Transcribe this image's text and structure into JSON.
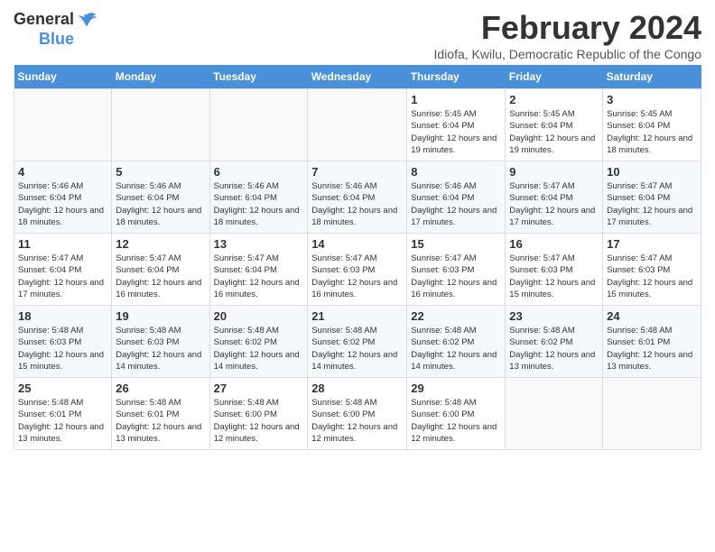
{
  "logo": {
    "text_general": "General",
    "text_blue": "Blue"
  },
  "header": {
    "title": "February 2024",
    "subtitle": "Idiofa, Kwilu, Democratic Republic of the Congo"
  },
  "weekdays": [
    "Sunday",
    "Monday",
    "Tuesday",
    "Wednesday",
    "Thursday",
    "Friday",
    "Saturday"
  ],
  "weeks": [
    [
      {
        "day": "",
        "empty": true
      },
      {
        "day": "",
        "empty": true
      },
      {
        "day": "",
        "empty": true
      },
      {
        "day": "",
        "empty": true
      },
      {
        "day": "1",
        "sunrise": "5:45 AM",
        "sunset": "6:04 PM",
        "daylight": "12 hours and 19 minutes."
      },
      {
        "day": "2",
        "sunrise": "5:45 AM",
        "sunset": "6:04 PM",
        "daylight": "12 hours and 19 minutes."
      },
      {
        "day": "3",
        "sunrise": "5:45 AM",
        "sunset": "6:04 PM",
        "daylight": "12 hours and 18 minutes."
      }
    ],
    [
      {
        "day": "4",
        "sunrise": "5:46 AM",
        "sunset": "6:04 PM",
        "daylight": "12 hours and 18 minutes."
      },
      {
        "day": "5",
        "sunrise": "5:46 AM",
        "sunset": "6:04 PM",
        "daylight": "12 hours and 18 minutes."
      },
      {
        "day": "6",
        "sunrise": "5:46 AM",
        "sunset": "6:04 PM",
        "daylight": "12 hours and 18 minutes."
      },
      {
        "day": "7",
        "sunrise": "5:46 AM",
        "sunset": "6:04 PM",
        "daylight": "12 hours and 18 minutes."
      },
      {
        "day": "8",
        "sunrise": "5:46 AM",
        "sunset": "6:04 PM",
        "daylight": "12 hours and 17 minutes."
      },
      {
        "day": "9",
        "sunrise": "5:47 AM",
        "sunset": "6:04 PM",
        "daylight": "12 hours and 17 minutes."
      },
      {
        "day": "10",
        "sunrise": "5:47 AM",
        "sunset": "6:04 PM",
        "daylight": "12 hours and 17 minutes."
      }
    ],
    [
      {
        "day": "11",
        "sunrise": "5:47 AM",
        "sunset": "6:04 PM",
        "daylight": "12 hours and 17 minutes."
      },
      {
        "day": "12",
        "sunrise": "5:47 AM",
        "sunset": "6:04 PM",
        "daylight": "12 hours and 16 minutes."
      },
      {
        "day": "13",
        "sunrise": "5:47 AM",
        "sunset": "6:04 PM",
        "daylight": "12 hours and 16 minutes."
      },
      {
        "day": "14",
        "sunrise": "5:47 AM",
        "sunset": "6:03 PM",
        "daylight": "12 hours and 16 minutes."
      },
      {
        "day": "15",
        "sunrise": "5:47 AM",
        "sunset": "6:03 PM",
        "daylight": "12 hours and 16 minutes."
      },
      {
        "day": "16",
        "sunrise": "5:47 AM",
        "sunset": "6:03 PM",
        "daylight": "12 hours and 15 minutes."
      },
      {
        "day": "17",
        "sunrise": "5:47 AM",
        "sunset": "6:03 PM",
        "daylight": "12 hours and 15 minutes."
      }
    ],
    [
      {
        "day": "18",
        "sunrise": "5:48 AM",
        "sunset": "6:03 PM",
        "daylight": "12 hours and 15 minutes."
      },
      {
        "day": "19",
        "sunrise": "5:48 AM",
        "sunset": "6:03 PM",
        "daylight": "12 hours and 14 minutes."
      },
      {
        "day": "20",
        "sunrise": "5:48 AM",
        "sunset": "6:02 PM",
        "daylight": "12 hours and 14 minutes."
      },
      {
        "day": "21",
        "sunrise": "5:48 AM",
        "sunset": "6:02 PM",
        "daylight": "12 hours and 14 minutes."
      },
      {
        "day": "22",
        "sunrise": "5:48 AM",
        "sunset": "6:02 PM",
        "daylight": "12 hours and 14 minutes."
      },
      {
        "day": "23",
        "sunrise": "5:48 AM",
        "sunset": "6:02 PM",
        "daylight": "12 hours and 13 minutes."
      },
      {
        "day": "24",
        "sunrise": "5:48 AM",
        "sunset": "6:01 PM",
        "daylight": "12 hours and 13 minutes."
      }
    ],
    [
      {
        "day": "25",
        "sunrise": "5:48 AM",
        "sunset": "6:01 PM",
        "daylight": "12 hours and 13 minutes."
      },
      {
        "day": "26",
        "sunrise": "5:48 AM",
        "sunset": "6:01 PM",
        "daylight": "12 hours and 13 minutes."
      },
      {
        "day": "27",
        "sunrise": "5:48 AM",
        "sunset": "6:00 PM",
        "daylight": "12 hours and 12 minutes."
      },
      {
        "day": "28",
        "sunrise": "5:48 AM",
        "sunset": "6:00 PM",
        "daylight": "12 hours and 12 minutes."
      },
      {
        "day": "29",
        "sunrise": "5:48 AM",
        "sunset": "6:00 PM",
        "daylight": "12 hours and 12 minutes."
      },
      {
        "day": "",
        "empty": true
      },
      {
        "day": "",
        "empty": true
      }
    ]
  ]
}
